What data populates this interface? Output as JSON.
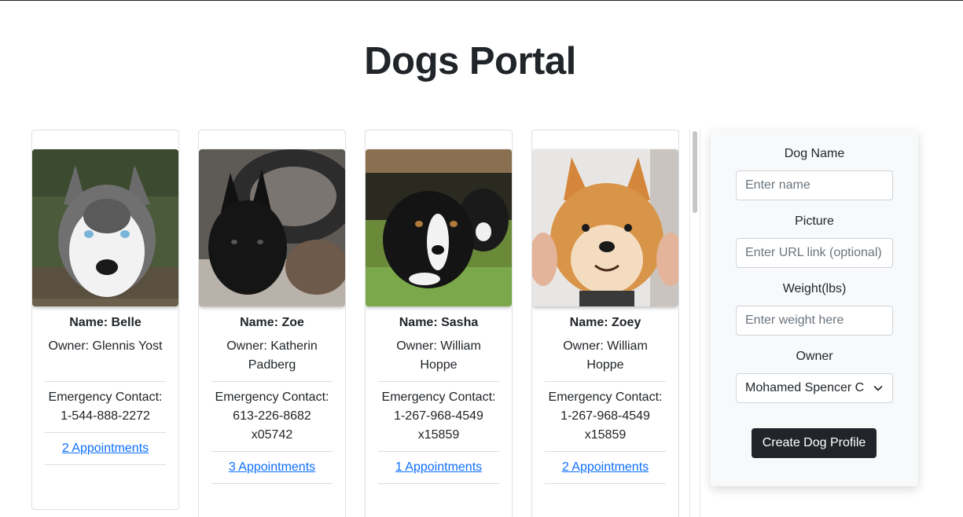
{
  "page": {
    "title": "Dogs Portal"
  },
  "dogs": [
    {
      "name": "Name: Belle",
      "owner": "Owner: Glennis Yost",
      "emergency": "Emergency Contact: 1-544-888-2272",
      "appointments": "2 Appointments"
    },
    {
      "name": "Name: Zoe",
      "owner": "Owner: Katherin Padberg",
      "emergency": "Emergency Contact: 613-226-8682 x05742",
      "appointments": "3 Appointments"
    },
    {
      "name": "Name: Sasha",
      "owner": "Owner: William Hoppe",
      "emergency": "Emergency Contact: 1-267-968-4549 x15859",
      "appointments": "1 Appointments"
    },
    {
      "name": "Name: Zoey",
      "owner": "Owner: William Hoppe",
      "emergency": "Emergency Contact: 1-267-968-4549 x15859",
      "appointments": "2 Appointments"
    }
  ],
  "form": {
    "dog_name_label": "Dog Name",
    "dog_name_placeholder": "Enter name",
    "picture_label": "Picture",
    "picture_placeholder": "Enter URL link (optional)",
    "weight_label": "Weight(lbs)",
    "weight_placeholder": "Enter weight here",
    "owner_label": "Owner",
    "owner_selected": "Mohamed Spencer C",
    "submit_label": "Create Dog Profile"
  },
  "colors": {
    "link": "#0d6efd",
    "button": "#212529",
    "panel": "#f8f9fa"
  }
}
